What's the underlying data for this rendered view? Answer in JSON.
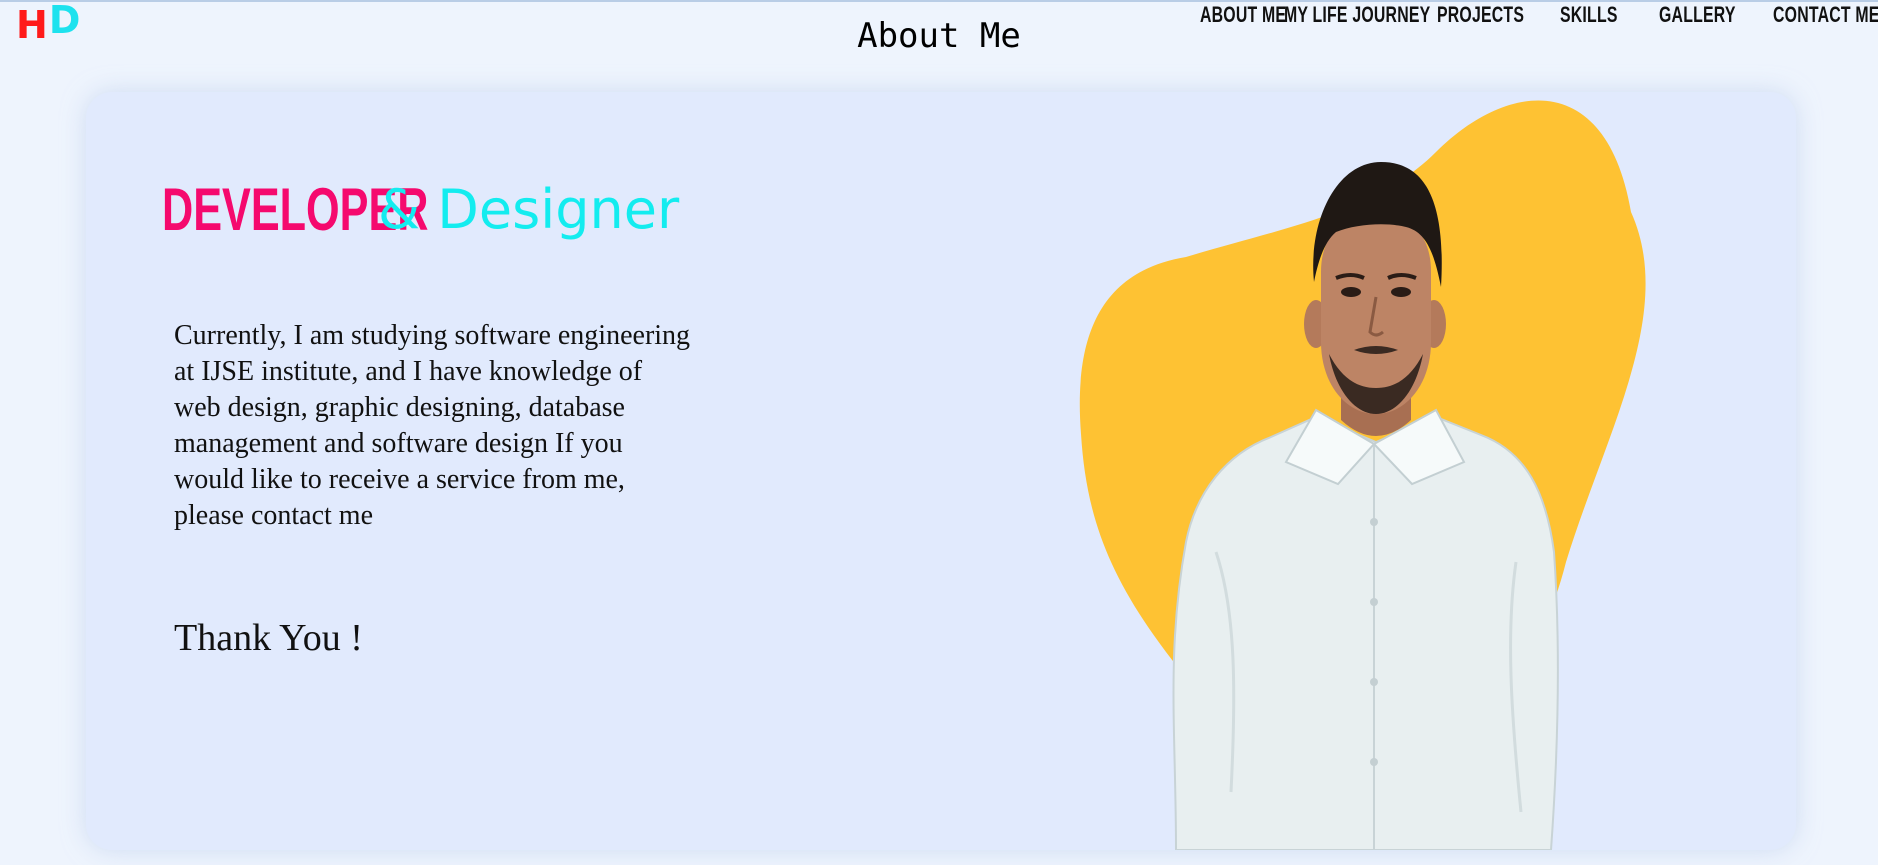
{
  "logo": {
    "letter_1": "H",
    "letter_2": "D"
  },
  "header": {
    "title": "About Me"
  },
  "nav": {
    "items": [
      "ABOUT ME",
      "MY LIFE JOURNEY",
      "PROJECTS",
      "SKILLS",
      "GALLERY",
      "CONTACT ME"
    ]
  },
  "hero": {
    "headline_part1": "DEVELOPER",
    "headline_part2": "& Designer",
    "bio": "Currently, I am studying software engineering at IJSE institute, and I have knowledge of web design, graphic designing, database management and software design If you would like to receive a service from me, please contact me",
    "thanks": "Thank You !"
  },
  "colors": {
    "page_bg": "#eef4fd",
    "card_bg": "#e1eafd",
    "developer": "#f5096e",
    "designer": "#13ecef",
    "blob": "#fec233",
    "logo_h": "#ff1a1a",
    "logo_d": "#1de2ee"
  },
  "icons": {
    "profile_photo": "person-portrait"
  }
}
